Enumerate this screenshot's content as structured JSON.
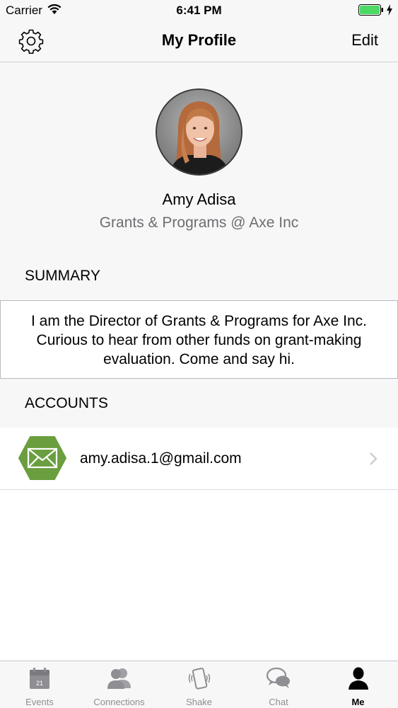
{
  "status": {
    "carrier": "Carrier",
    "time": "6:41 PM",
    "battery_color": "#4cd964"
  },
  "nav": {
    "title": "My Profile",
    "edit_label": "Edit",
    "settings_icon": "gear-icon"
  },
  "profile": {
    "name": "Amy Adisa",
    "title": "Grants & Programs @ Axe Inc"
  },
  "summary": {
    "header": "SUMMARY",
    "text": "I am the Director of Grants & Programs for Axe Inc. Curious to hear from other funds on grant-making evaluation. Come and say hi."
  },
  "accounts": {
    "header": "ACCOUNTS",
    "items": [
      {
        "icon": "mail-icon",
        "email": "amy.adisa.1@gmail.com",
        "icon_color": "#6a9e3f"
      }
    ]
  },
  "tabs": [
    {
      "label": "Events",
      "icon": "calendar-icon",
      "calendar_day": "21"
    },
    {
      "label": "Connections",
      "icon": "people-icon"
    },
    {
      "label": "Shake",
      "icon": "shake-phone-icon"
    },
    {
      "label": "Chat",
      "icon": "chat-bubbles-icon"
    },
    {
      "label": "Me",
      "icon": "person-icon",
      "active": true
    }
  ]
}
